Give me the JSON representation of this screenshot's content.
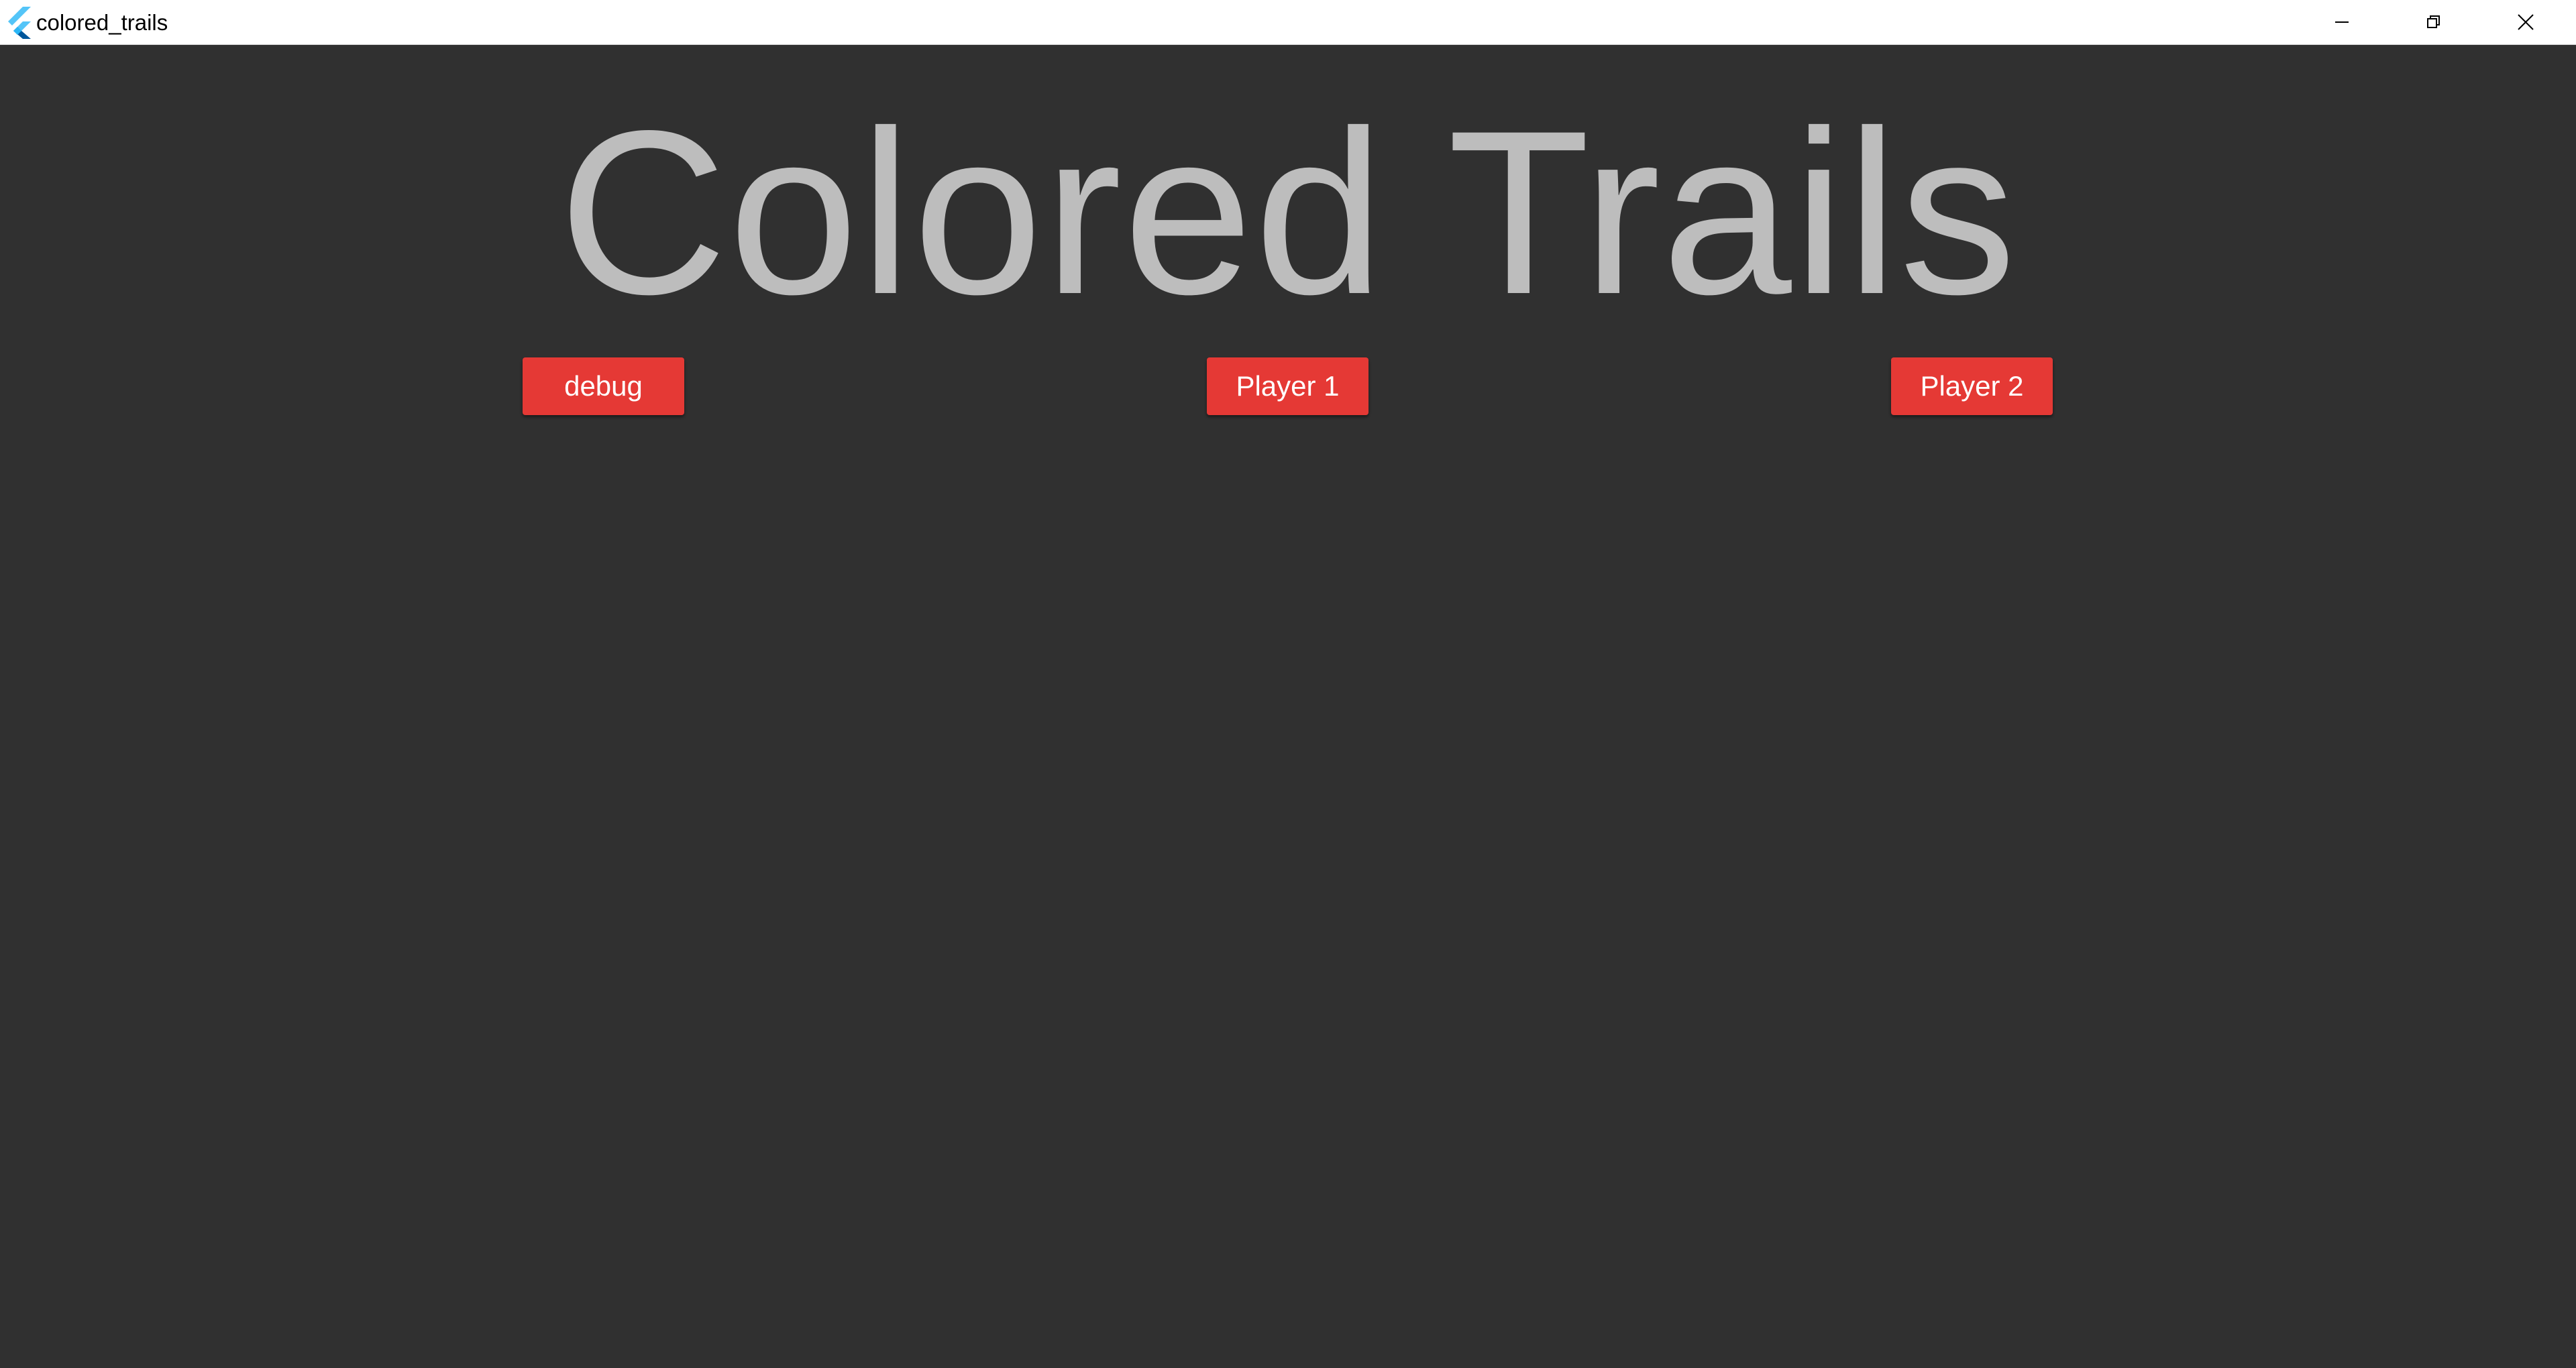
{
  "window": {
    "title": "colored_trails",
    "app_icon": "flutter-logo-icon",
    "controls": {
      "minimize_icon": "minimize-icon",
      "restore_icon": "restore-icon",
      "close_icon": "close-icon"
    }
  },
  "main": {
    "title": "Colored Trails",
    "buttons": {
      "debug": "debug",
      "player1": "Player 1",
      "player2": "Player 2"
    }
  },
  "colors": {
    "background": "#303030",
    "title_text": "#bdbdbd",
    "button": "#e53935",
    "button_text": "#ffffff",
    "titlebar": "#ffffff"
  }
}
